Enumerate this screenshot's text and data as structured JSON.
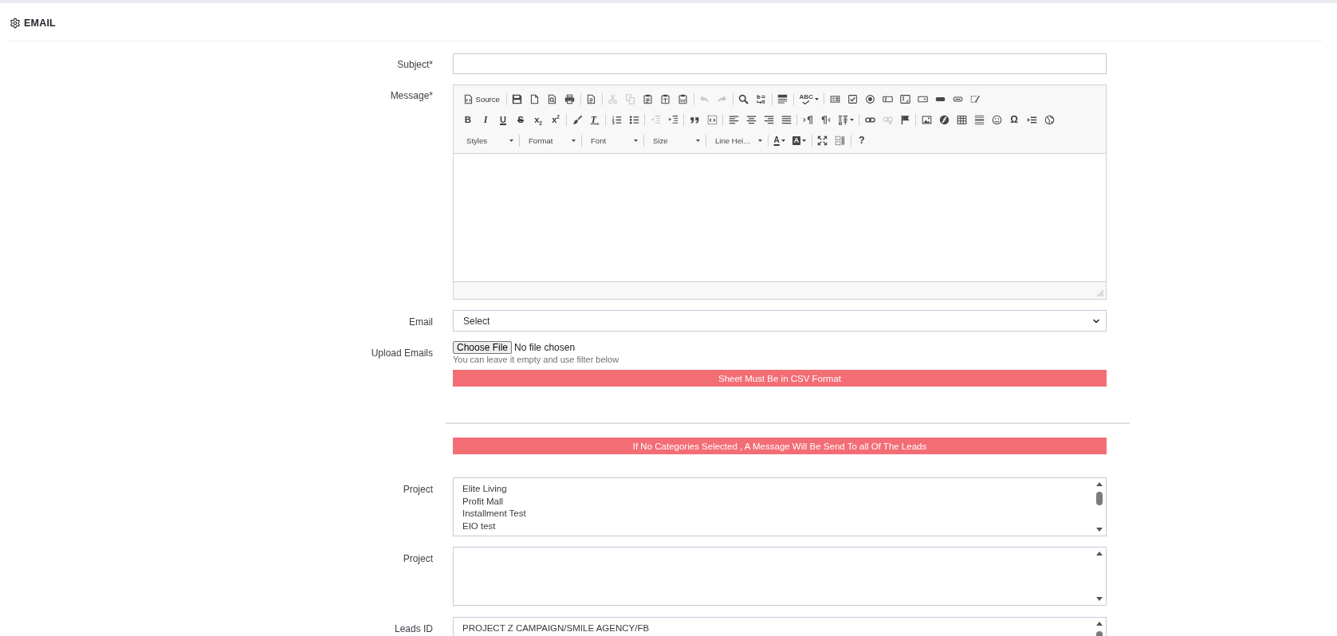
{
  "header": {
    "title": "EMAIL"
  },
  "subject": {
    "label": "Subject*"
  },
  "message": {
    "label": "Message*",
    "toolbar_rows": [
      [
        [
          {
            "kind": "source",
            "label": "Source",
            "disabled": false
          }
        ],
        [
          {
            "kind": "save",
            "disabled": false
          },
          {
            "kind": "new-page",
            "disabled": false
          },
          {
            "kind": "preview",
            "disabled": false
          },
          {
            "kind": "print",
            "disabled": false
          }
        ],
        [
          {
            "kind": "templates",
            "disabled": false
          }
        ],
        [
          {
            "kind": "cut",
            "disabled": true
          },
          {
            "kind": "copy",
            "disabled": true
          },
          {
            "kind": "paste",
            "disabled": false
          },
          {
            "kind": "paste-text",
            "disabled": false
          },
          {
            "kind": "paste-word",
            "disabled": false
          }
        ],
        [
          {
            "kind": "undo",
            "disabled": true
          },
          {
            "kind": "redo",
            "disabled": true
          }
        ],
        [
          {
            "kind": "find",
            "disabled": false
          },
          {
            "kind": "replace",
            "disabled": false
          }
        ],
        [
          {
            "kind": "select-all",
            "disabled": false
          }
        ],
        [
          {
            "kind": "spellcheck",
            "glyph": "ABC",
            "disabled": false
          }
        ],
        [
          {
            "kind": "form",
            "disabled": false
          },
          {
            "kind": "checkbox",
            "disabled": false
          },
          {
            "kind": "radio",
            "disabled": false
          },
          {
            "kind": "text-field",
            "disabled": false
          },
          {
            "kind": "textarea",
            "disabled": false
          },
          {
            "kind": "select",
            "disabled": false
          },
          {
            "kind": "button",
            "disabled": false
          },
          {
            "kind": "image-button",
            "disabled": false
          },
          {
            "kind": "hidden-field",
            "disabled": false
          }
        ]
      ],
      [
        [
          {
            "kind": "bold",
            "glyph": "B",
            "disabled": false
          },
          {
            "kind": "italic",
            "glyph": "I",
            "disabled": false
          },
          {
            "kind": "underline",
            "glyph": "U",
            "disabled": false
          },
          {
            "kind": "strike",
            "glyph": "S",
            "disabled": false
          },
          {
            "kind": "subscript",
            "glyph": "x$_{2}$",
            "disabled": false
          },
          {
            "kind": "superscript",
            "glyph": "x$^{2}$",
            "disabled": false
          }
        ],
        [
          {
            "kind": "copy-format",
            "disabled": false
          },
          {
            "kind": "remove-format",
            "glyph": "T$_{x}$",
            "disabled": false
          }
        ],
        [
          {
            "kind": "numbered-list",
            "disabled": false
          },
          {
            "kind": "bulleted-list",
            "disabled": false
          }
        ],
        [
          {
            "kind": "outdent",
            "disabled": true
          },
          {
            "kind": "indent",
            "disabled": false
          }
        ],
        [
          {
            "kind": "blockquote",
            "disabled": false
          },
          {
            "kind": "div",
            "disabled": false
          }
        ],
        [
          {
            "kind": "align-left",
            "disabled": false
          },
          {
            "kind": "align-center",
            "disabled": false
          },
          {
            "kind": "align-right",
            "disabled": false
          },
          {
            "kind": "justify",
            "disabled": false
          }
        ],
        [
          {
            "kind": "ltr",
            "disabled": false
          },
          {
            "kind": "rtl",
            "disabled": false
          },
          {
            "kind": "language",
            "disabled": false
          }
        ],
        [
          {
            "kind": "link",
            "disabled": false
          },
          {
            "kind": "unlink",
            "disabled": true
          },
          {
            "kind": "anchor",
            "disabled": false
          }
        ],
        [
          {
            "kind": "image",
            "disabled": false
          },
          {
            "kind": "flash",
            "disabled": false
          },
          {
            "kind": "table",
            "disabled": false
          },
          {
            "kind": "hr",
            "disabled": false
          },
          {
            "kind": "smiley",
            "disabled": false
          },
          {
            "kind": "special-char",
            "glyph": "Ω",
            "disabled": false
          },
          {
            "kind": "page-break",
            "disabled": false
          },
          {
            "kind": "iframe",
            "disabled": false
          }
        ]
      ],
      [
        [
          {
            "kind": "combo",
            "label": "Styles",
            "disabled": false
          }
        ],
        [
          {
            "kind": "combo",
            "label": "Format",
            "disabled": false
          }
        ],
        [
          {
            "kind": "combo",
            "label": "Font",
            "disabled": false
          }
        ],
        [
          {
            "kind": "combo",
            "label": "Size",
            "disabled": false
          }
        ],
        [
          {
            "kind": "combo",
            "label": "Line Hei…",
            "disabled": false
          }
        ],
        [
          {
            "kind": "text-color",
            "glyph": "A",
            "disabled": false
          },
          {
            "kind": "bg-color",
            "glyph": "A",
            "disabled": false
          }
        ],
        [
          {
            "kind": "maximize",
            "disabled": false
          },
          {
            "kind": "show-blocks",
            "disabled": false
          }
        ],
        [
          {
            "kind": "about",
            "glyph": "?",
            "disabled": false
          }
        ]
      ]
    ]
  },
  "email": {
    "label": "Email",
    "value": "Select"
  },
  "upload": {
    "label": "Upload Emails",
    "button": "Choose File",
    "status": "No file chosen",
    "hint": "You can leave it empty and use filter below",
    "format_notice": "Sheet Must Be in CSV Format"
  },
  "categories_notice": "If No Categories Selected , A Message Will Be Send To all Of The Leads",
  "lists": [
    {
      "label": "Project",
      "options": [
        {
          "text": "Elite Living",
          "selected": false
        },
        {
          "text": "Profit Mall",
          "selected": false
        },
        {
          "text": "Installment Test",
          "selected": false
        },
        {
          "text": "EIO test",
          "selected": false
        }
      ]
    },
    {
      "label": "Project"
    },
    {
      "label": "Leads ID",
      "options": [
        {
          "text": "PROJECT Z CAMPAIGN/SMILE AGENCY/FB",
          "selected": false
        }
      ]
    }
  ]
}
